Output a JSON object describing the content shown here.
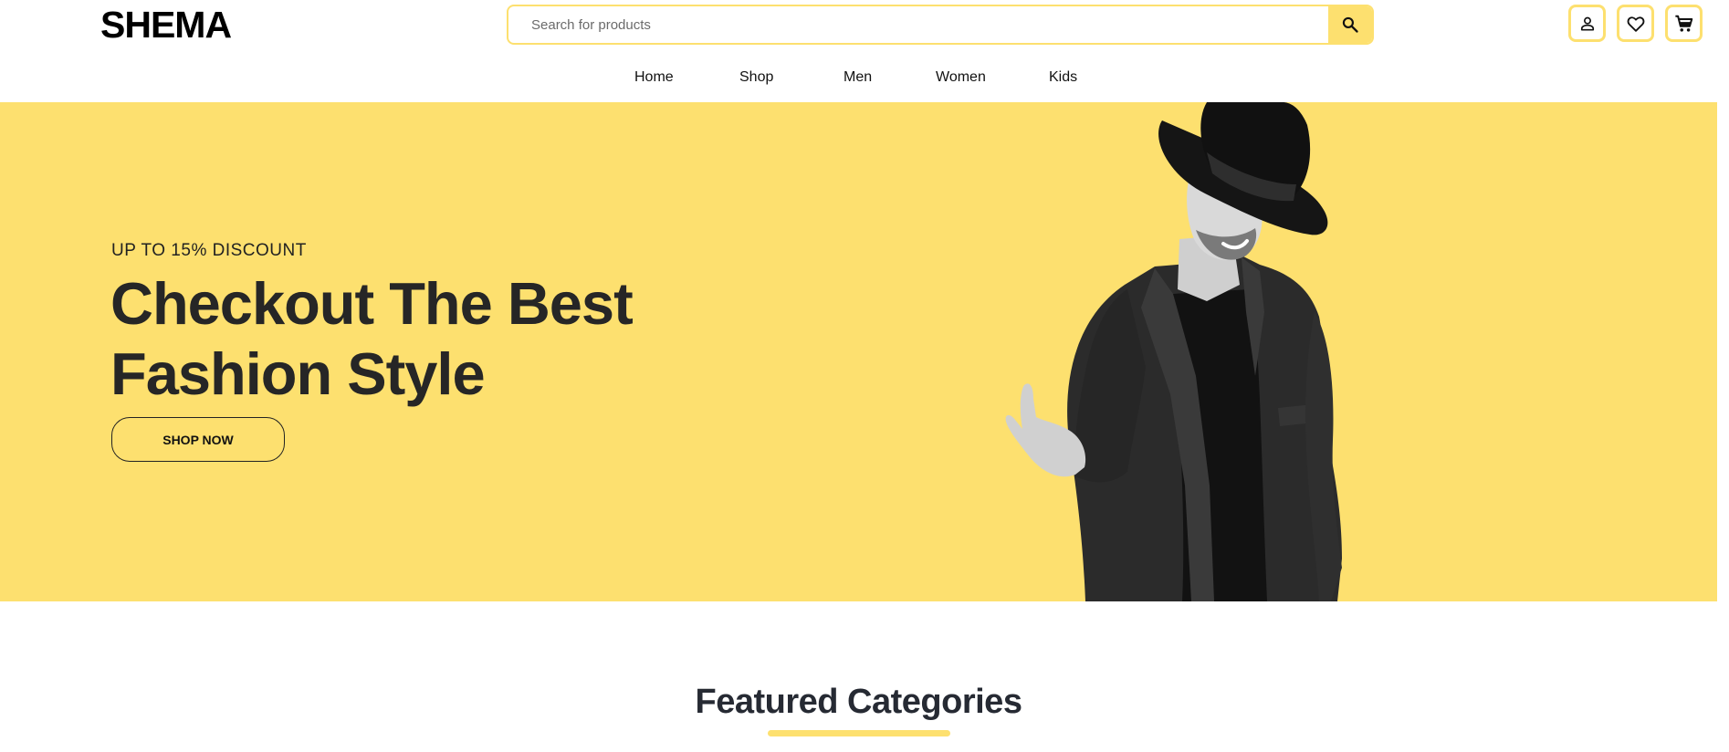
{
  "brand": {
    "logo": "SHEMA",
    "accent_color": "#fde06f"
  },
  "search": {
    "placeholder": "Search for products",
    "value": "",
    "button_icon": "search-icon"
  },
  "header_icons": [
    "user-icon",
    "heart-icon",
    "cart-icon"
  ],
  "nav": {
    "items": [
      {
        "label": "Home"
      },
      {
        "label": "Shop"
      },
      {
        "label": "Men"
      },
      {
        "label": "Women"
      },
      {
        "label": "Kids"
      }
    ]
  },
  "hero": {
    "eyebrow": "UP TO 15% DISCOUNT",
    "title_line1": "Checkout The Best",
    "title_line2": "Fashion Style",
    "cta_label": "SHOP NOW",
    "background_color": "#fde06f"
  },
  "featured": {
    "title": "Featured Categories"
  }
}
